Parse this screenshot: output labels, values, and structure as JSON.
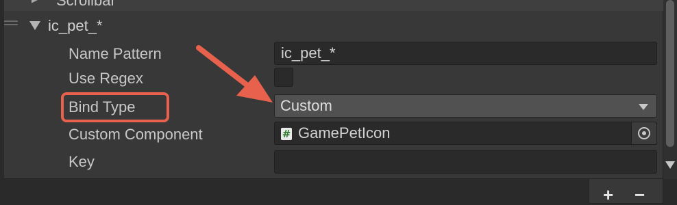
{
  "previous_item": {
    "label": "Scrollbar"
  },
  "element": {
    "title": "ic_pet_*"
  },
  "fields": {
    "name_pattern": {
      "label": "Name Pattern",
      "value": "ic_pet_*"
    },
    "use_regex": {
      "label": "Use Regex",
      "checked": false
    },
    "bind_type": {
      "label": "Bind Type",
      "value": "Custom"
    },
    "custom_component": {
      "label": "Custom Component",
      "value": "GamePetIcon"
    },
    "key": {
      "label": "Key",
      "value": ""
    }
  },
  "footer": {
    "add_label": "+",
    "remove_label": "−"
  },
  "colors": {
    "annotation": "#e8614d",
    "panel": "#383838",
    "field": "#2a2a2a"
  },
  "icons": {
    "script": "csharp-script-icon",
    "picker": "object-picker-icon",
    "foldout": "triangle-down-icon",
    "drag": "drag-handle-icon"
  }
}
